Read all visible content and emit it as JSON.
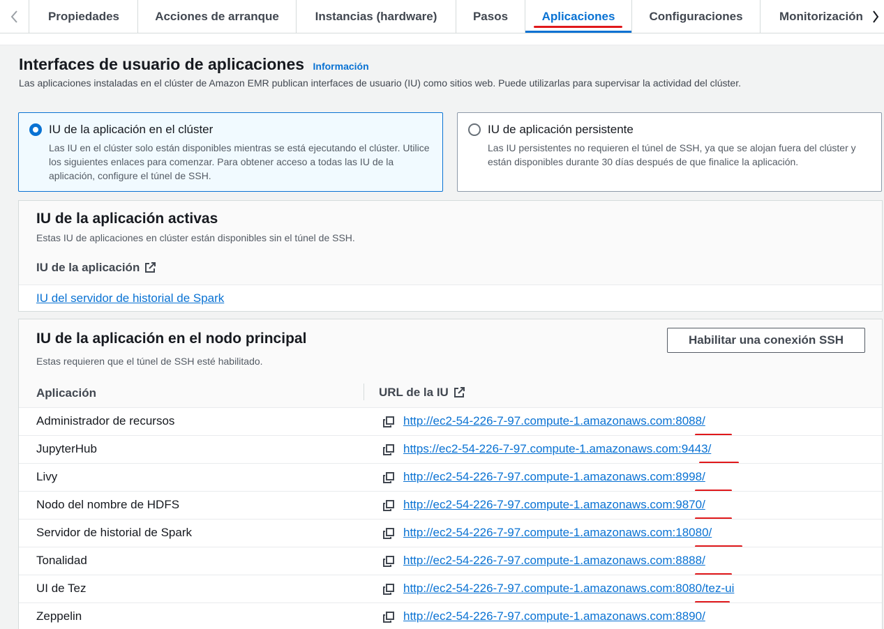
{
  "tabs": {
    "items": [
      {
        "label": "Propiedades"
      },
      {
        "label": "Acciones de arranque"
      },
      {
        "label": "Instancias (hardware)"
      },
      {
        "label": "Pasos"
      },
      {
        "label": "Aplicaciones"
      },
      {
        "label": "Configuraciones"
      },
      {
        "label": "Monitorización"
      }
    ],
    "active": "Aplicaciones"
  },
  "section": {
    "title": "Interfaces de usuario de aplicaciones",
    "info": "Información",
    "description": "Las aplicaciones instaladas en el clúster de Amazon EMR publican interfaces de usuario (IU) como sitios web. Puede utilizarlas para supervisar la actividad del clúster."
  },
  "options": [
    {
      "label": "IU de la aplicación en el clúster",
      "description": "Las IU en el clúster solo están disponibles mientras se está ejecutando el clúster. Utilice los siguientes enlaces para comenzar. Para obtener acceso a todas las IU de la aplicación, configure el túnel de SSH.",
      "selected": true
    },
    {
      "label": "IU de aplicación persistente",
      "description": "Las IU persistentes no requieren el túnel de SSH, ya que se alojan fuera del clúster y están disponibles durante 30 días después de que finalice la aplicación.",
      "selected": false
    }
  ],
  "active_panel": {
    "title": "IU de la aplicación activas",
    "description": "Estas IU de aplicaciones en clúster están disponibles sin el túnel de SSH.",
    "column": "IU de la aplicación",
    "link": "IU del servidor de historial de Spark"
  },
  "primary_panel": {
    "title": "IU de la aplicación en el nodo principal",
    "description": "Estas requieren que el túnel de SSH esté habilitado.",
    "button": "Habilitar una conexión SSH",
    "columns": {
      "app": "Aplicación",
      "url": "URL de la IU"
    },
    "rows": [
      {
        "app": "Administrador de recursos",
        "url": "http://ec2-54-226-7-97.compute-1.amazonaws.com:8088/"
      },
      {
        "app": "JupyterHub",
        "url": "https://ec2-54-226-7-97.compute-1.amazonaws.com:9443/"
      },
      {
        "app": "Livy",
        "url": "http://ec2-54-226-7-97.compute-1.amazonaws.com:8998/"
      },
      {
        "app": "Nodo del nombre de HDFS",
        "url": "http://ec2-54-226-7-97.compute-1.amazonaws.com:9870/"
      },
      {
        "app": "Servidor de historial de Spark",
        "url": "http://ec2-54-226-7-97.compute-1.amazonaws.com:18080/"
      },
      {
        "app": "Tonalidad",
        "url": "http://ec2-54-226-7-97.compute-1.amazonaws.com:8888/"
      },
      {
        "app": "UI de Tez",
        "url": "http://ec2-54-226-7-97.compute-1.amazonaws.com:8080/tez-ui"
      },
      {
        "app": "Zeppelin",
        "url": "http://ec2-54-226-7-97.compute-1.amazonaws.com:8890/"
      }
    ]
  },
  "colors": {
    "accent": "#0972d3",
    "annotation": "#e0181b"
  }
}
